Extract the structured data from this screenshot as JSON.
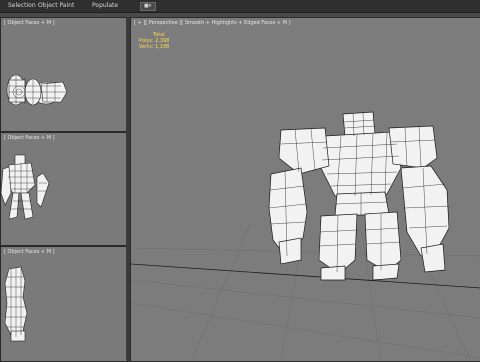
{
  "menu": {
    "tabs": [
      "Selection",
      "Object Paint",
      "Populate"
    ],
    "dropdown_icon": "panel-dropdown-icon"
  },
  "viewports": {
    "top_label": "[ Object Faces + M ]",
    "front_label": "[ Object Faces + M ]",
    "left_label": "[ Object Faces + M ]",
    "perspective_label": "[ + ][ Perspective ][ Smooth + Highlights + Edged Faces + M ]"
  },
  "stats": {
    "heading": "Total",
    "polys": "Polys: 2,398",
    "verts": "Verts: 1,198"
  },
  "colors": {
    "viewport_bg": "#7a7a7a",
    "wire": "#222222",
    "model_fill": "#f2f2f2",
    "stats_text": "#ffd84a"
  }
}
